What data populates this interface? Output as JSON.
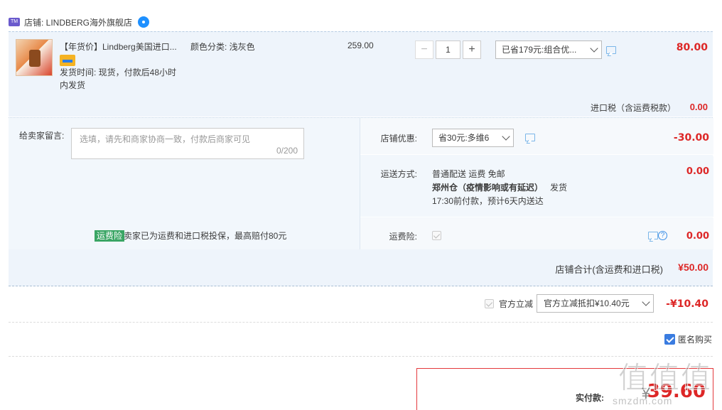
{
  "shop": {
    "label": "店铺: LINDBERG海外旗舰店",
    "badge_icon": "tmall-shop-icon",
    "chat_icon": "wangwang-chat-icon"
  },
  "item": {
    "title": "【年货价】Lindberg美国进口...",
    "sku": "颜色分类: 浅灰色",
    "ship_time": "发货时间: 现货，付款后48小时内发货",
    "unit_price": "259.00",
    "quantity": "1",
    "minus": "−",
    "plus": "+",
    "promo": "已省179元:组合优...",
    "total": "80.00",
    "tax_label": "进口税（含运费税款）",
    "tax_value": "0.00"
  },
  "memo": {
    "label": "给卖家留言:",
    "placeholder": "选填，请先和商家协商一致，付款后商家可见",
    "count": "0/200"
  },
  "coupon": {
    "label": "店铺优惠:",
    "value": "省30元:多维6",
    "amount": "-30.00"
  },
  "shipping": {
    "label": "运送方式:",
    "line1": "普通配送 运费 免邮",
    "line2_bold": "郑州仓（疫情影响或有延迟）",
    "line2_rest": "发货",
    "line3": "17:30前付款，预计6天内送达",
    "amount": "0.00"
  },
  "insurance": {
    "label": "运费险:",
    "tag": "运费险",
    "text": "卖家已为运费和进口税投保，最高赔付80元",
    "amount": "0.00"
  },
  "shop_total": {
    "label": "店铺合计(含运费和进口税)",
    "value": "¥50.00"
  },
  "official": {
    "label": "官方立减",
    "select": "官方立减抵扣¥10.40元",
    "amount": "-¥10.40"
  },
  "anonymous": {
    "label": "匿名购买",
    "checked": true
  },
  "payment": {
    "label": "实付款:",
    "currency": "¥",
    "amount": "39.60"
  },
  "watermark": {
    "main": "值值值",
    "sub": "smzdm.com"
  },
  "colors": {
    "accent_red": "#dd2727",
    "link_blue": "#3a7ce0",
    "row_bg": "#eef4fb"
  }
}
